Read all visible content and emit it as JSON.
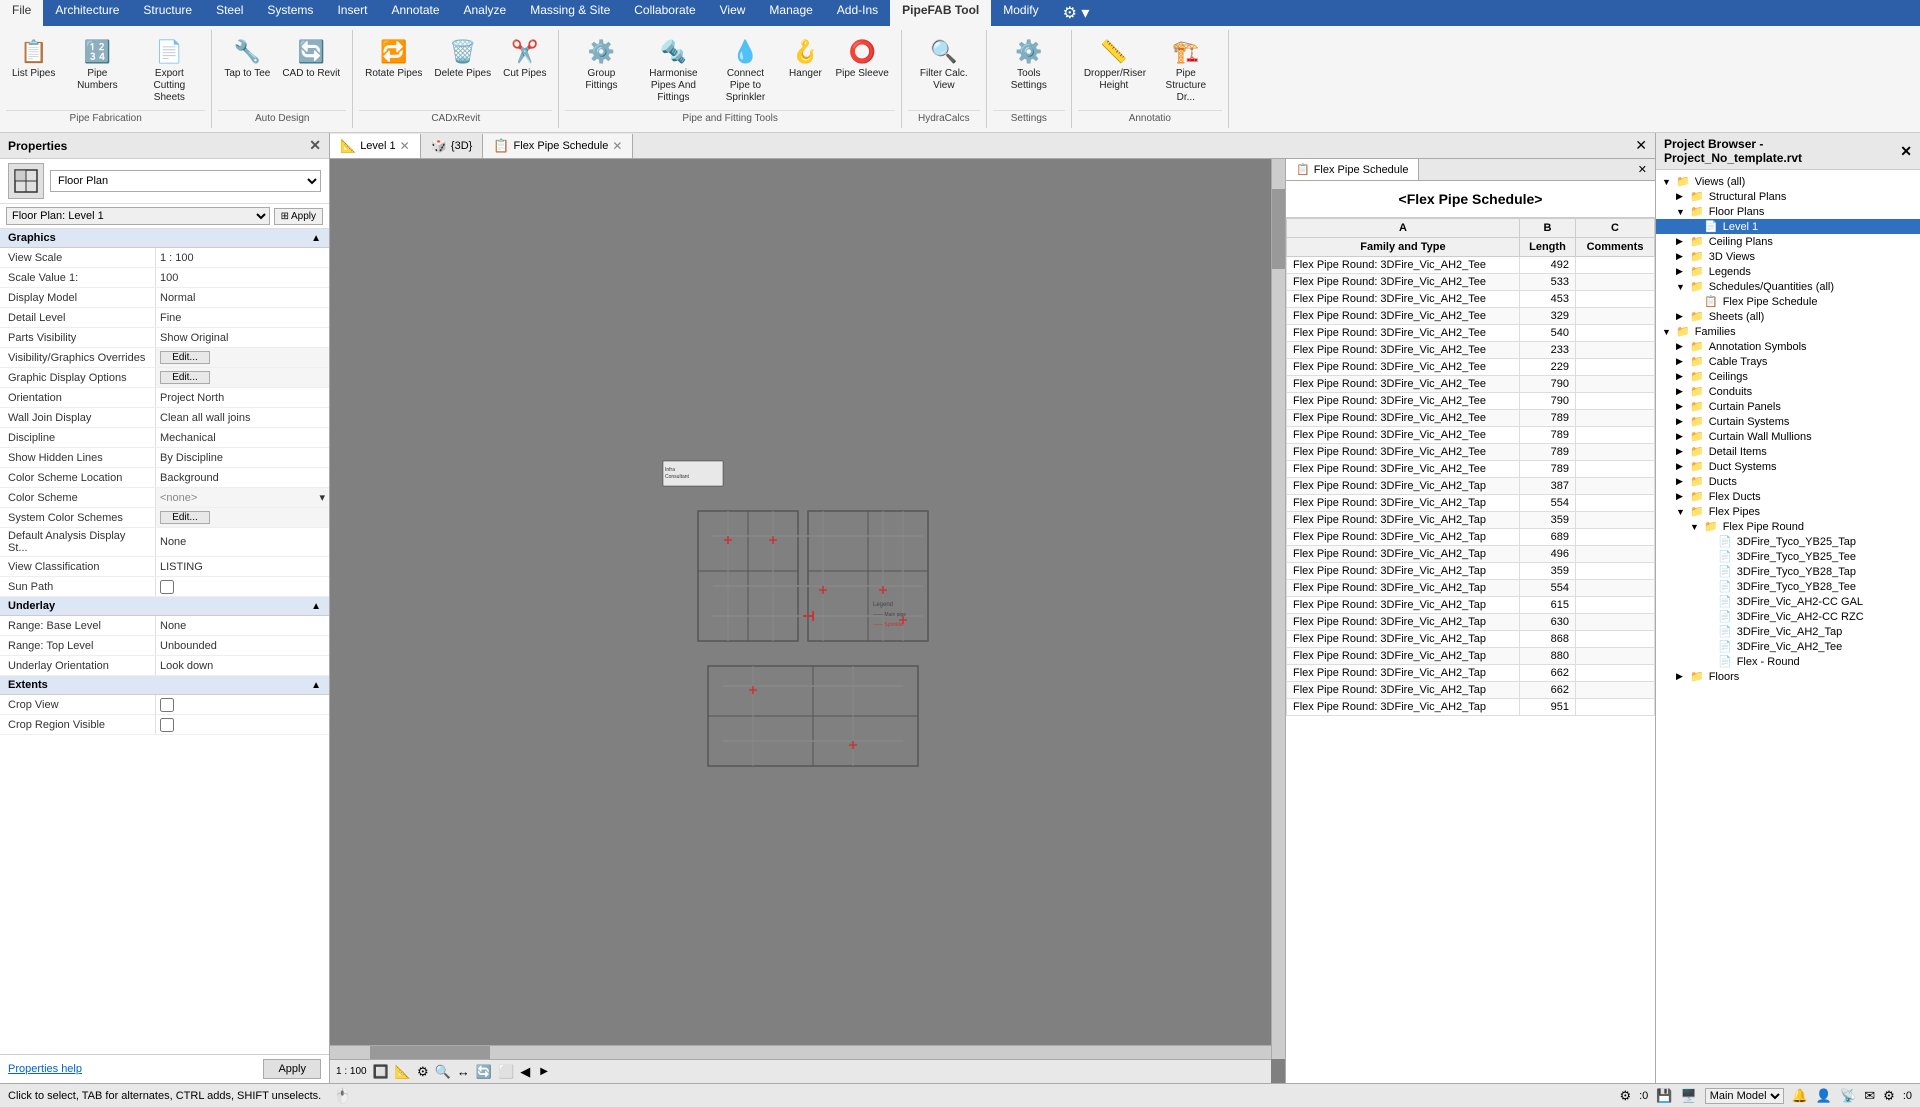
{
  "ribbon": {
    "tabs": [
      "File",
      "Architecture",
      "Structure",
      "Steel",
      "Systems",
      "Insert",
      "Annotate",
      "Analyze",
      "Massing & Site",
      "Collaborate",
      "View",
      "Manage",
      "Add-Ins",
      "PipeFAB Tool",
      "Modify"
    ],
    "active_tab": "PipeFAB Tool",
    "groups": [
      {
        "label": "Pipe Fabrication",
        "items": [
          {
            "id": "list-pipes",
            "label": "List Pipes",
            "icon": "📋"
          },
          {
            "id": "pipe-numbers",
            "label": "Pipe Numbers",
            "icon": "🔢"
          },
          {
            "id": "export-cutting",
            "label": "Export Cutting Sheets",
            "icon": "📄"
          }
        ]
      },
      {
        "label": "Auto Design",
        "items": [
          {
            "id": "tap-to-tee",
            "label": "Tap to Tee",
            "icon": "🔧"
          },
          {
            "id": "cad-to-revit",
            "label": "CAD to Revit",
            "icon": "🔄"
          }
        ]
      },
      {
        "label": "CADxRevit",
        "items": [
          {
            "id": "rotate-pipes",
            "label": "Rotate Pipes",
            "icon": "🔁"
          },
          {
            "id": "delete-pipes",
            "label": "Delete Pipes",
            "icon": "🗑️"
          },
          {
            "id": "cut-pipes",
            "label": "Cut Pipes",
            "icon": "✂️"
          }
        ]
      },
      {
        "label": "Pipe and Fitting Tools",
        "items": [
          {
            "id": "group-fittings",
            "label": "Group Fittings",
            "icon": "⚙️"
          },
          {
            "id": "harmonise-pipes",
            "label": "Harmonise Pipes And Fittings",
            "icon": "🔩"
          },
          {
            "id": "connect-pipe",
            "label": "Connect Pipe to Sprinkler",
            "icon": "💧"
          },
          {
            "id": "hanger",
            "label": "Hanger",
            "icon": "🪝"
          },
          {
            "id": "pipe-sleeve",
            "label": "Pipe Sleeve",
            "icon": "⭕"
          }
        ]
      },
      {
        "label": "HydraCalcs",
        "items": [
          {
            "id": "filter-calc-view",
            "label": "Filter Calc. View",
            "icon": "🔍"
          }
        ]
      },
      {
        "label": "Settings",
        "items": [
          {
            "id": "tools-settings",
            "label": "Tools Settings",
            "icon": "⚙️"
          }
        ]
      },
      {
        "label": "Annotatio",
        "items": [
          {
            "id": "dropper-riser",
            "label": "Dropper/Riser Height",
            "icon": "📏"
          },
          {
            "id": "pipe-structure",
            "label": "Pipe Structure Dr...",
            "icon": "🏗️"
          }
        ]
      }
    ]
  },
  "properties": {
    "title": "Properties",
    "type": "Floor Plan",
    "view_name": "Floor Plan: Level 1",
    "sections": {
      "graphics": {
        "label": "Graphics",
        "rows": [
          {
            "label": "View Scale",
            "value": "1 : 100"
          },
          {
            "label": "Scale Value  1:",
            "value": "100"
          },
          {
            "label": "Display Model",
            "value": "Normal"
          },
          {
            "label": "Detail Level",
            "value": "Fine"
          },
          {
            "label": "Parts Visibility",
            "value": "Show Original"
          },
          {
            "label": "Visibility/Graphics Overrides",
            "value": "Edit...",
            "is_button": true
          },
          {
            "label": "Graphic Display Options",
            "value": "Edit...",
            "is_button": true
          },
          {
            "label": "Orientation",
            "value": "Project North"
          },
          {
            "label": "Wall Join Display",
            "value": "Clean all wall joins"
          },
          {
            "label": "Discipline",
            "value": "Mechanical"
          },
          {
            "label": "Show Hidden Lines",
            "value": "By Discipline"
          },
          {
            "label": "Color Scheme Location",
            "value": "Background"
          },
          {
            "label": "Color Scheme",
            "value": "<none>",
            "is_dropdown": true
          },
          {
            "label": "System Color Schemes",
            "value": "Edit...",
            "is_button": true
          },
          {
            "label": "Default Analysis Display St...",
            "value": "None"
          },
          {
            "label": "View Classification",
            "value": "LISTING"
          },
          {
            "label": "Sun Path",
            "value": "",
            "is_checkbox": true
          }
        ]
      },
      "underlay": {
        "label": "Underlay",
        "rows": [
          {
            "label": "Range: Base Level",
            "value": "None"
          },
          {
            "label": "Range: Top Level",
            "value": "Unbounded"
          },
          {
            "label": "Underlay Orientation",
            "value": "Look down"
          }
        ]
      },
      "extents": {
        "label": "Extents",
        "rows": [
          {
            "label": "Crop View",
            "value": "",
            "is_checkbox": true
          },
          {
            "label": "Crop Region Visible",
            "value": "",
            "is_checkbox": true
          }
        ]
      }
    },
    "help_text": "Properties help",
    "apply_label": "Apply"
  },
  "views": {
    "tabs": [
      {
        "id": "level1",
        "label": "Level 1",
        "icon": "📐",
        "active": true
      },
      {
        "id": "3d",
        "label": "{3D}",
        "icon": "🎲",
        "active": false
      },
      {
        "id": "flex-schedule",
        "label": "Flex Pipe Schedule",
        "icon": "📋",
        "active": false
      }
    ]
  },
  "schedule": {
    "title": "<Flex Pipe Schedule>",
    "columns": [
      {
        "id": "A",
        "label": "A",
        "sub": "Family and Type"
      },
      {
        "id": "B",
        "label": "B",
        "sub": "Length"
      },
      {
        "id": "C",
        "label": "C",
        "sub": "Comments"
      }
    ],
    "rows": [
      {
        "family": "Flex Pipe Round: 3DFire_Vic_AH2_Tee",
        "length": "492",
        "comments": ""
      },
      {
        "family": "Flex Pipe Round: 3DFire_Vic_AH2_Tee",
        "length": "533",
        "comments": ""
      },
      {
        "family": "Flex Pipe Round: 3DFire_Vic_AH2_Tee",
        "length": "453",
        "comments": ""
      },
      {
        "family": "Flex Pipe Round: 3DFire_Vic_AH2_Tee",
        "length": "329",
        "comments": ""
      },
      {
        "family": "Flex Pipe Round: 3DFire_Vic_AH2_Tee",
        "length": "540",
        "comments": ""
      },
      {
        "family": "Flex Pipe Round: 3DFire_Vic_AH2_Tee",
        "length": "233",
        "comments": ""
      },
      {
        "family": "Flex Pipe Round: 3DFire_Vic_AH2_Tee",
        "length": "229",
        "comments": ""
      },
      {
        "family": "Flex Pipe Round: 3DFire_Vic_AH2_Tee",
        "length": "790",
        "comments": ""
      },
      {
        "family": "Flex Pipe Round: 3DFire_Vic_AH2_Tee",
        "length": "790",
        "comments": ""
      },
      {
        "family": "Flex Pipe Round: 3DFire_Vic_AH2_Tee",
        "length": "789",
        "comments": ""
      },
      {
        "family": "Flex Pipe Round: 3DFire_Vic_AH2_Tee",
        "length": "789",
        "comments": ""
      },
      {
        "family": "Flex Pipe Round: 3DFire_Vic_AH2_Tee",
        "length": "789",
        "comments": ""
      },
      {
        "family": "Flex Pipe Round: 3DFire_Vic_AH2_Tee",
        "length": "789",
        "comments": ""
      },
      {
        "family": "Flex Pipe Round: 3DFire_Vic_AH2_Tap",
        "length": "387",
        "comments": ""
      },
      {
        "family": "Flex Pipe Round: 3DFire_Vic_AH2_Tap",
        "length": "554",
        "comments": ""
      },
      {
        "family": "Flex Pipe Round: 3DFire_Vic_AH2_Tap",
        "length": "359",
        "comments": ""
      },
      {
        "family": "Flex Pipe Round: 3DFire_Vic_AH2_Tap",
        "length": "689",
        "comments": ""
      },
      {
        "family": "Flex Pipe Round: 3DFire_Vic_AH2_Tap",
        "length": "496",
        "comments": ""
      },
      {
        "family": "Flex Pipe Round: 3DFire_Vic_AH2_Tap",
        "length": "359",
        "comments": ""
      },
      {
        "family": "Flex Pipe Round: 3DFire_Vic_AH2_Tap",
        "length": "554",
        "comments": ""
      },
      {
        "family": "Flex Pipe Round: 3DFire_Vic_AH2_Tap",
        "length": "615",
        "comments": ""
      },
      {
        "family": "Flex Pipe Round: 3DFire_Vic_AH2_Tap",
        "length": "630",
        "comments": ""
      },
      {
        "family": "Flex Pipe Round: 3DFire_Vic_AH2_Tap",
        "length": "868",
        "comments": ""
      },
      {
        "family": "Flex Pipe Round: 3DFire_Vic_AH2_Tap",
        "length": "880",
        "comments": ""
      },
      {
        "family": "Flex Pipe Round: 3DFire_Vic_AH2_Tap",
        "length": "662",
        "comments": ""
      },
      {
        "family": "Flex Pipe Round: 3DFire_Vic_AH2_Tap",
        "length": "662",
        "comments": ""
      },
      {
        "family": "Flex Pipe Round: 3DFire_Vic_AH2_Tap",
        "length": "951",
        "comments": ""
      }
    ]
  },
  "project_browser": {
    "title": "Project Browser - Project_No_template.rvt",
    "tree": [
      {
        "label": "Views (all)",
        "level": 0,
        "expanded": true,
        "icon": "📁"
      },
      {
        "label": "Structural Plans",
        "level": 1,
        "expanded": false,
        "icon": "📁"
      },
      {
        "label": "Floor Plans",
        "level": 1,
        "expanded": true,
        "icon": "📁"
      },
      {
        "label": "Level 1",
        "level": 2,
        "selected": true,
        "icon": "📄"
      },
      {
        "label": "Ceiling Plans",
        "level": 1,
        "expanded": false,
        "icon": "📁"
      },
      {
        "label": "3D Views",
        "level": 1,
        "expanded": false,
        "icon": "📁"
      },
      {
        "label": "Legends",
        "level": 1,
        "expanded": false,
        "icon": "📁"
      },
      {
        "label": "Schedules/Quantities (all)",
        "level": 1,
        "expanded": true,
        "icon": "📁"
      },
      {
        "label": "Flex Pipe Schedule",
        "level": 2,
        "icon": "📋"
      },
      {
        "label": "Sheets (all)",
        "level": 1,
        "expanded": false,
        "icon": "📁"
      },
      {
        "label": "Families",
        "level": 0,
        "expanded": true,
        "icon": "📁"
      },
      {
        "label": "Annotation Symbols",
        "level": 1,
        "expanded": false,
        "icon": "📁"
      },
      {
        "label": "Cable Trays",
        "level": 1,
        "expanded": false,
        "icon": "📁"
      },
      {
        "label": "Ceilings",
        "level": 1,
        "expanded": false,
        "icon": "📁"
      },
      {
        "label": "Conduits",
        "level": 1,
        "expanded": false,
        "icon": "📁"
      },
      {
        "label": "Curtain Panels",
        "level": 1,
        "expanded": false,
        "icon": "📁"
      },
      {
        "label": "Curtain Systems",
        "level": 1,
        "expanded": false,
        "icon": "📁"
      },
      {
        "label": "Curtain Wall Mullions",
        "level": 1,
        "expanded": false,
        "icon": "📁"
      },
      {
        "label": "Detail Items",
        "level": 1,
        "expanded": false,
        "icon": "📁"
      },
      {
        "label": "Duct Systems",
        "level": 1,
        "expanded": false,
        "icon": "📁"
      },
      {
        "label": "Ducts",
        "level": 1,
        "expanded": false,
        "icon": "📁"
      },
      {
        "label": "Flex Ducts",
        "level": 1,
        "expanded": false,
        "icon": "📁"
      },
      {
        "label": "Flex Pipes",
        "level": 1,
        "expanded": true,
        "icon": "📁"
      },
      {
        "label": "Flex Pipe Round",
        "level": 2,
        "expanded": true,
        "icon": "📁"
      },
      {
        "label": "3DFire_Tyco_YB25_Tap",
        "level": 3,
        "icon": "📄"
      },
      {
        "label": "3DFire_Tyco_YB25_Tee",
        "level": 3,
        "icon": "📄"
      },
      {
        "label": "3DFire_Tyco_YB28_Tap",
        "level": 3,
        "icon": "📄"
      },
      {
        "label": "3DFire_Tyco_YB28_Tee",
        "level": 3,
        "icon": "📄"
      },
      {
        "label": "3DFire_Vic_AH2-CC GAL",
        "level": 3,
        "icon": "📄"
      },
      {
        "label": "3DFire_Vic_AH2-CC RZC",
        "level": 3,
        "icon": "📄"
      },
      {
        "label": "3DFire_Vic_AH2_Tap",
        "level": 3,
        "icon": "📄"
      },
      {
        "label": "3DFire_Vic_AH2_Tee",
        "level": 3,
        "icon": "📄"
      },
      {
        "label": "Flex - Round",
        "level": 3,
        "icon": "📄"
      },
      {
        "label": "Floors",
        "level": 1,
        "expanded": false,
        "icon": "📁"
      }
    ]
  },
  "status_bar": {
    "message": "Click to select, TAB for alternates, CTRL adds, SHIFT unselects.",
    "model": "Main Model",
    "scale": "1 : 100"
  },
  "view_bottom": {
    "scale": "1 : 100"
  }
}
